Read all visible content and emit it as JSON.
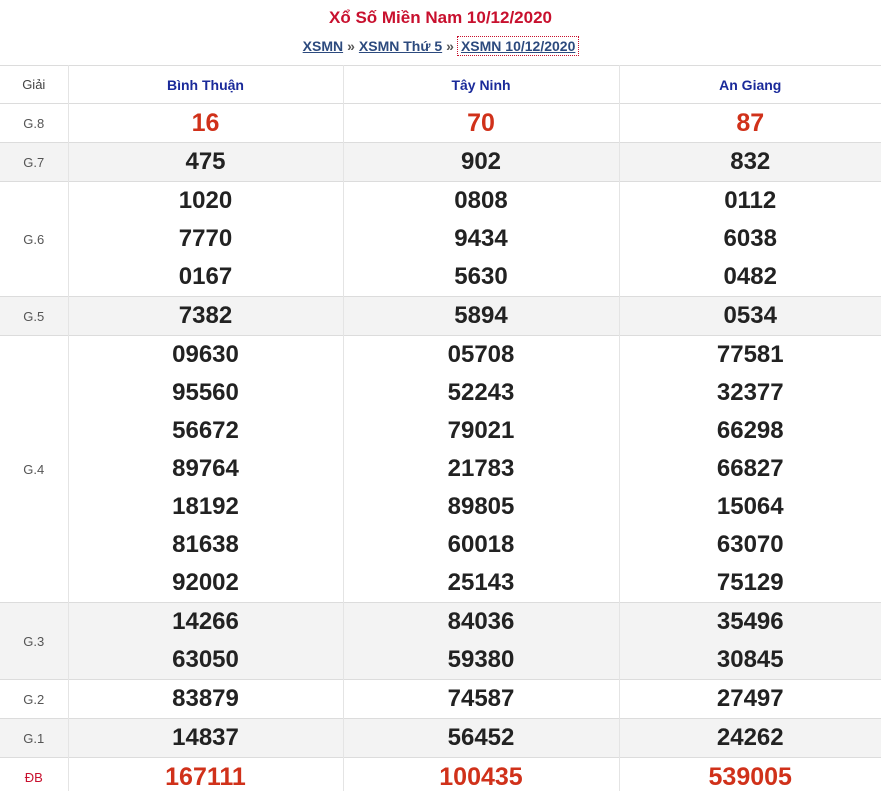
{
  "title": "Xổ Số Miền Nam 10/12/2020",
  "breadcrumb": {
    "items": [
      "XSMN",
      "XSMN Thứ 5",
      "XSMN 10/12/2020"
    ],
    "separator": "»"
  },
  "table": {
    "header": {
      "label": "Giải",
      "provinces": [
        "Bình Thuận",
        "Tây Ninh",
        "An Giang"
      ]
    },
    "rows": [
      {
        "label": "G.8",
        "shade": false,
        "red": true,
        "cols": [
          [
            "16"
          ],
          [
            "70"
          ],
          [
            "87"
          ]
        ]
      },
      {
        "label": "G.7",
        "shade": true,
        "red": false,
        "cols": [
          [
            "475"
          ],
          [
            "902"
          ],
          [
            "832"
          ]
        ]
      },
      {
        "label": "G.6",
        "shade": false,
        "red": false,
        "cols": [
          [
            "1020",
            "7770",
            "0167"
          ],
          [
            "0808",
            "9434",
            "5630"
          ],
          [
            "0112",
            "6038",
            "0482"
          ]
        ]
      },
      {
        "label": "G.5",
        "shade": true,
        "red": false,
        "cols": [
          [
            "7382"
          ],
          [
            "5894"
          ],
          [
            "0534"
          ]
        ]
      },
      {
        "label": "G.4",
        "shade": false,
        "red": false,
        "cols": [
          [
            "09630",
            "95560",
            "56672",
            "89764",
            "18192",
            "81638",
            "92002"
          ],
          [
            "05708",
            "52243",
            "79021",
            "21783",
            "89805",
            "60018",
            "25143"
          ],
          [
            "77581",
            "32377",
            "66298",
            "66827",
            "15064",
            "63070",
            "75129"
          ]
        ]
      },
      {
        "label": "G.3",
        "shade": true,
        "red": false,
        "cols": [
          [
            "14266",
            "63050"
          ],
          [
            "84036",
            "59380"
          ],
          [
            "35496",
            "30845"
          ]
        ]
      },
      {
        "label": "G.2",
        "shade": false,
        "red": false,
        "cols": [
          [
            "83879"
          ],
          [
            "74587"
          ],
          [
            "27497"
          ]
        ]
      },
      {
        "label": "G.1",
        "shade": true,
        "red": false,
        "cols": [
          [
            "14837"
          ],
          [
            "56452"
          ],
          [
            "24262"
          ]
        ]
      },
      {
        "label": "ĐB",
        "shade": false,
        "red": true,
        "cols": [
          [
            "167111"
          ],
          [
            "100435"
          ],
          [
            "539005"
          ]
        ]
      }
    ]
  },
  "colors": {
    "title": "#c8102e",
    "province": "#1a2a9a",
    "link": "#2c4a7e",
    "special_number": "#d0311a",
    "row_shade": "#f3f3f3"
  }
}
